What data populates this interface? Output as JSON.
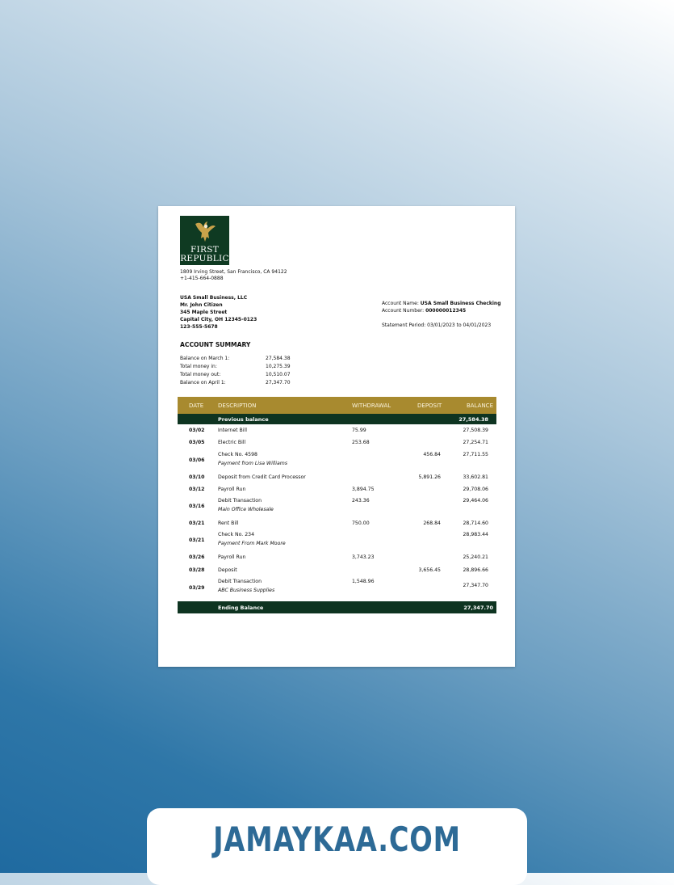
{
  "bank": {
    "logo_line1": "First",
    "logo_line2": "Republic",
    "address": "1809 Irving Street, San Francisco, CA 94122",
    "phone": "+1-415-664-0888"
  },
  "customer": {
    "company": "USA Small Business, LLC",
    "name": "Mr. John Citizen",
    "street": "345 Maple Street",
    "city": "Capital City, OH 12345-0123",
    "phone": "123-555-5678"
  },
  "account": {
    "name_label": "Account Name:",
    "name_value": "USA Small Business Checking",
    "number_label": "Account Number:",
    "number_value": "000000012345",
    "period_label": "Statement Period:",
    "period_value": "03/01/2023 to 04/01/2023"
  },
  "summary": {
    "title": "ACCOUNT SUMMARY",
    "rows": [
      {
        "label": "Balance on March 1:",
        "value": "27,584.38"
      },
      {
        "label": "Total money in:",
        "value": "10,275.39"
      },
      {
        "label": "Total money out:",
        "value": "10,510.07"
      },
      {
        "label": "Balance on April 1:",
        "value": "27,347.70"
      }
    ]
  },
  "table": {
    "headers": {
      "date": "DATE",
      "description": "DESCRIPTION",
      "withdrawal": "WITHDRAWAL",
      "deposit": "DEPOSIT",
      "balance": "BALANCE"
    },
    "previous_label": "Previous balance",
    "previous_value": "27,584.38",
    "rows": [
      {
        "date": "03/02",
        "desc": "Internet Bill",
        "sub": "",
        "withdrawal": "75.99",
        "deposit": "",
        "balance": "27,508.39"
      },
      {
        "date": "03/05",
        "desc": "Electric Bill",
        "sub": "",
        "withdrawal": "253.68",
        "deposit": "",
        "balance": "27,254.71"
      },
      {
        "date": "03/06",
        "desc": "Check No. 4598",
        "sub": "Payment from Lisa Williams",
        "withdrawal": "",
        "deposit": "456.84",
        "balance": "27,711.55"
      },
      {
        "date": "03/10",
        "desc": "Deposit from Credit Card Processor",
        "sub": "",
        "withdrawal": "",
        "deposit": "5,891.26",
        "balance": "33,602.81"
      },
      {
        "date": "03/12",
        "desc": "Payroll Run",
        "sub": "",
        "withdrawal": "3,894.75",
        "deposit": "",
        "balance": "29,708.06"
      },
      {
        "date": "03/16",
        "desc": "Debit Transaction",
        "sub": "Main Office Wholesale",
        "withdrawal": "243.36",
        "deposit": "",
        "balance": "29,464.06"
      },
      {
        "date": "03/21",
        "desc": "Rent Bill",
        "sub": "",
        "withdrawal": "750.00",
        "deposit": "268.84",
        "balance": "28,714.60"
      },
      {
        "date": "03/21",
        "desc": "Check No. 234",
        "sub": "Payment From Mark Moore",
        "withdrawal": "",
        "deposit": "",
        "balance": "28,983.44"
      },
      {
        "date": "03/26",
        "desc": "Payroll Run",
        "sub": "",
        "withdrawal": "3,743.23",
        "deposit": "",
        "balance": "25,240.21"
      },
      {
        "date": "03/28",
        "desc": "Deposit",
        "sub": "",
        "withdrawal": "",
        "deposit": "3,656.45",
        "balance": "28,896.66"
      },
      {
        "date": "03/29",
        "desc": "Debit Transaction",
        "sub": "ABC Business Supplies",
        "withdrawal": "1,548.96",
        "deposit": "",
        "balance": "27,347.70"
      }
    ],
    "ending_label": "Ending Balance",
    "ending_value": "27,347.70"
  },
  "watermark": {
    "text": "JAMAYKAA.COM"
  },
  "colors": {
    "header_gold": "#a88a2f",
    "dark_green": "#0e3421",
    "banner_text": "#2d6a96"
  }
}
